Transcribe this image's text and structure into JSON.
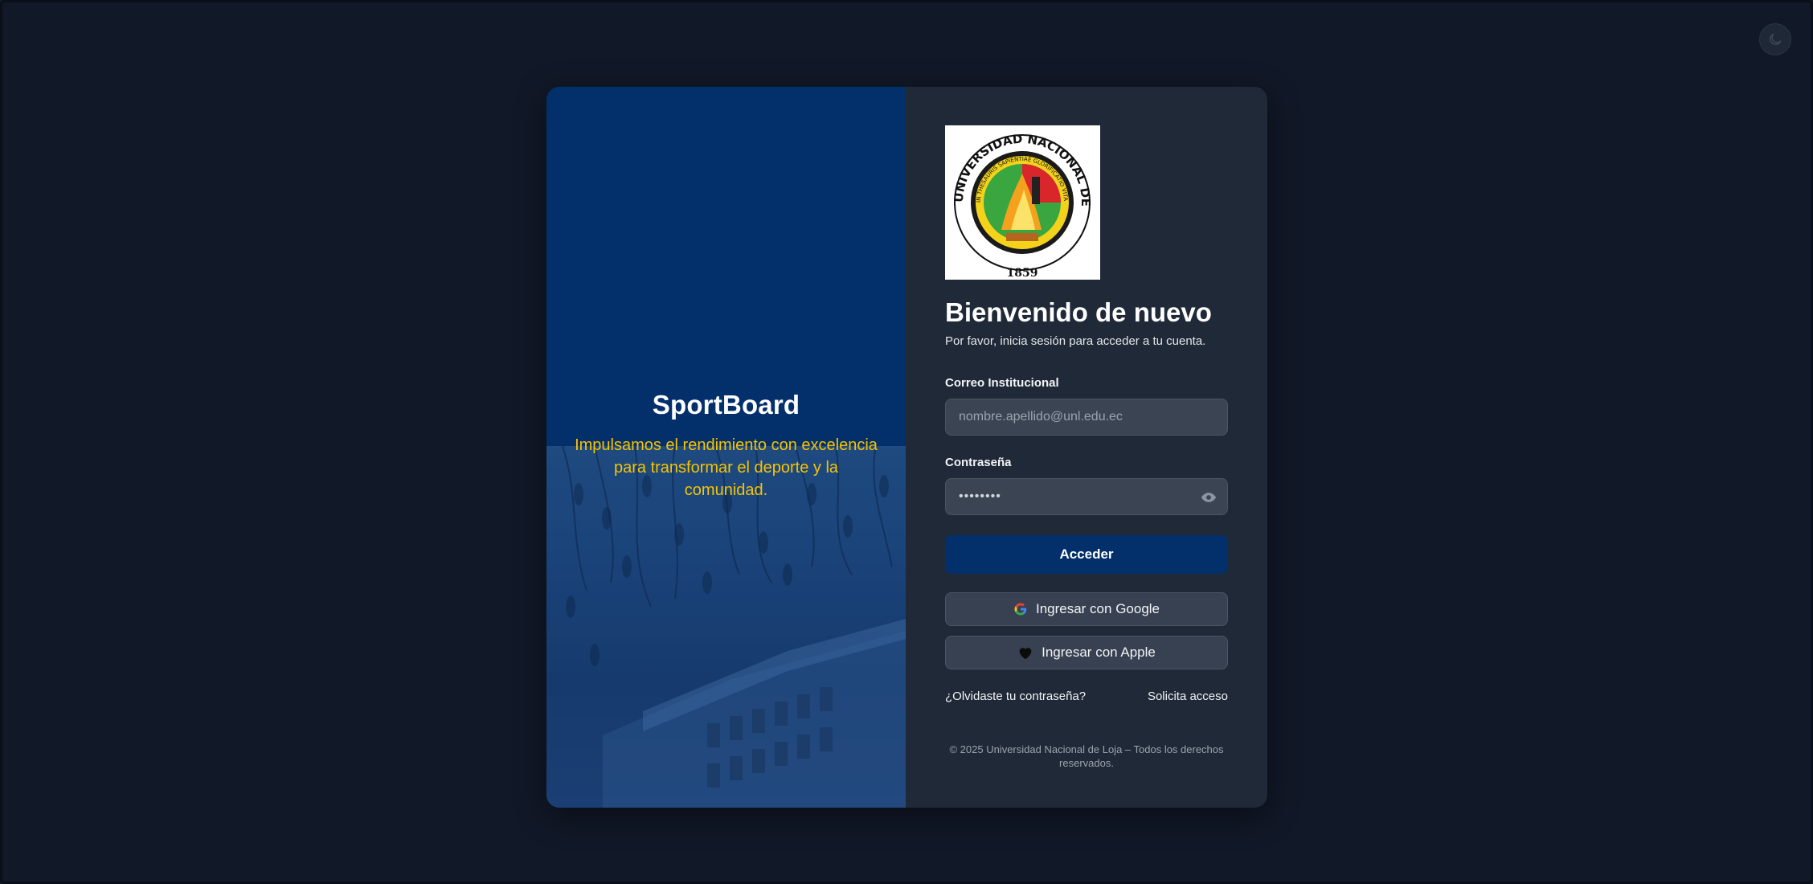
{
  "theme_toggle": {
    "icon": "moon-icon"
  },
  "brand": {
    "title": "SportBoard",
    "tagline": "Impulsamos el rendimiento con excelencia para transformar el deporte y la comunidad.",
    "accent_color": "#f7c300",
    "panel_color": "#03306b"
  },
  "logo": {
    "alt": "Universidad Nacional de Loja seal",
    "ring_text": "UNIVERSIDAD NACIONAL DE LOJA",
    "inner_text": "IN THESAURIS SAPIENTIAE GLORIFICATIO VITAE",
    "year": "1859"
  },
  "login": {
    "heading": "Bienvenido de nuevo",
    "subheading": "Por favor, inicia sesión para acceder a tu cuenta.",
    "email_label": "Correo Institucional",
    "email_placeholder": "nombre.apellido@unl.edu.ec",
    "email_value": "",
    "password_label": "Contraseña",
    "password_value": "••••••••",
    "submit_label": "Acceder",
    "google_label": "Ingresar con Google",
    "apple_label": "Ingresar con Apple",
    "forgot_label": "¿Olvidaste tu contraseña?",
    "request_access_label": "Solicita acceso"
  },
  "footer": {
    "text": "© 2025 Universidad Nacional de Loja – Todos los derechos reservados."
  }
}
